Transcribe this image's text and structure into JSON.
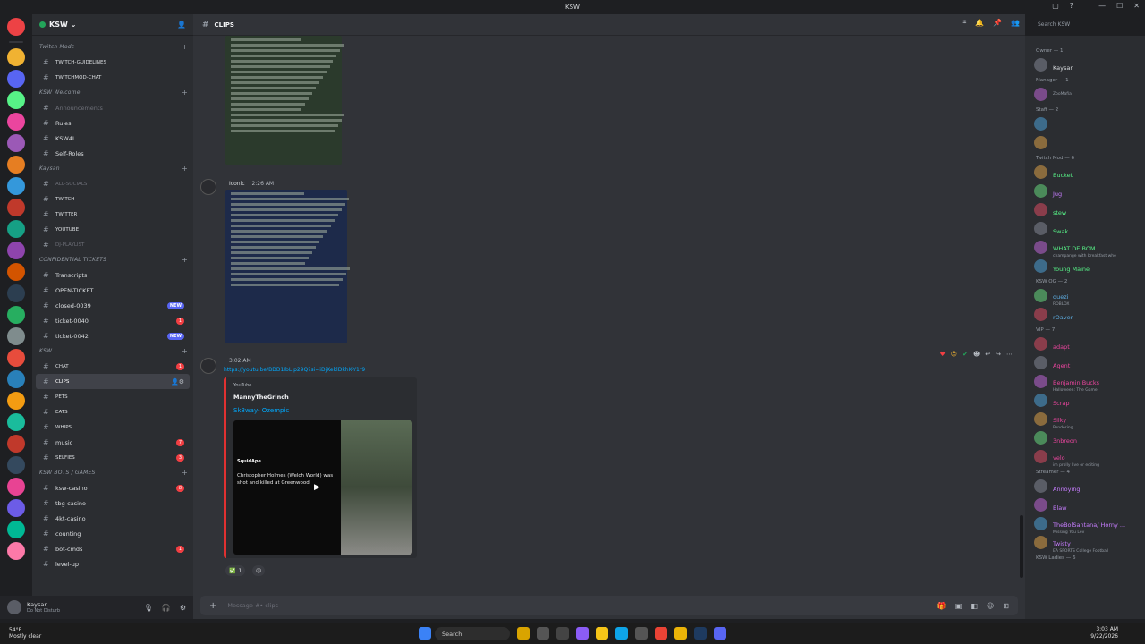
{
  "window": {
    "title": "KSW"
  },
  "server": {
    "name": "KSW"
  },
  "channels": [
    {
      "type": "cat",
      "label": "Twitch Mods"
    },
    {
      "type": "ch",
      "label": "TWITCH-GUIDELINES",
      "small": true
    },
    {
      "type": "ch",
      "label": "TWITCHMOD-CHAT",
      "small": true
    },
    {
      "type": "cat",
      "label": "KSW Welcome"
    },
    {
      "type": "ch",
      "label": "Announcements",
      "muted": true
    },
    {
      "type": "ch",
      "label": "Rules"
    },
    {
      "type": "ch",
      "label": "KSW4L"
    },
    {
      "type": "ch",
      "label": "Self-Roles"
    },
    {
      "type": "cat",
      "label": "Kaysan"
    },
    {
      "type": "ch",
      "label": "ALL-SOCIALS",
      "small": true,
      "muted": true
    },
    {
      "type": "ch",
      "label": "TWITCH",
      "small": true
    },
    {
      "type": "ch",
      "label": "TWITTER",
      "small": true
    },
    {
      "type": "ch",
      "label": "YOUTUBE",
      "small": true
    },
    {
      "type": "ch",
      "label": "DJ-PLAYLIST",
      "small": true,
      "muted": true
    },
    {
      "type": "cat",
      "label": "CONFIDENTIAL TICKETS"
    },
    {
      "type": "ch",
      "label": "Transcripts"
    },
    {
      "type": "ch",
      "label": "OPEN-TICKET"
    },
    {
      "type": "ch",
      "label": "closed-0039",
      "newb": "NEW"
    },
    {
      "type": "ch",
      "label": "ticket-0040",
      "badge": "1"
    },
    {
      "type": "ch",
      "label": "ticket-0042",
      "newb": "NEW"
    },
    {
      "type": "cat",
      "label": "KSW"
    },
    {
      "type": "ch",
      "label": "CHAT",
      "small": true,
      "badge": "1"
    },
    {
      "type": "ch",
      "label": "CLIPS",
      "small": true,
      "sel": true
    },
    {
      "type": "ch",
      "label": "PETS",
      "small": true
    },
    {
      "type": "ch",
      "label": "EATS",
      "small": true
    },
    {
      "type": "ch",
      "label": "WHIPS",
      "small": true
    },
    {
      "type": "ch",
      "label": "music",
      "badge": "7"
    },
    {
      "type": "ch",
      "label": "SELFIES",
      "small": true,
      "badge": "3"
    },
    {
      "type": "cat",
      "label": "KSW BOTS / GAMES"
    },
    {
      "type": "ch",
      "label": "ksw-casino",
      "badge": "8"
    },
    {
      "type": "ch",
      "label": "tbg-casino"
    },
    {
      "type": "ch",
      "label": "4kt-casino"
    },
    {
      "type": "ch",
      "label": "counting"
    },
    {
      "type": "ch",
      "label": "bot-cmds",
      "badge": "1"
    },
    {
      "type": "ch",
      "label": "level-up"
    }
  ],
  "user": {
    "name": "Kaysan",
    "status": "Do Not Disturb"
  },
  "header": {
    "channel": "CLIPS",
    "search_placeholder": "Search KSW"
  },
  "message2": {
    "author": "Iconic",
    "time": "2:26 AM"
  },
  "message3": {
    "time": "3:02 AM",
    "link": "https://youtu.be/BDD1IbL p29Q?si=iDjKeklDkhK-Y1r9"
  },
  "embed": {
    "provider": "YouTube",
    "author": "MannyTheGrinch",
    "title": "Sk8way- Ozempic",
    "tweet_account": "SquidApe",
    "tweet_text": "Christopher Holmes (Welch World) was shot and killed at Greenwood"
  },
  "reactions": {
    "check_count": "1"
  },
  "composer": {
    "placeholder": "Message #• clips"
  },
  "member_roles": [
    {
      "label": "Owner — 1",
      "members": [
        {
          "name": "Kaysan",
          "color": "#dbdee1"
        }
      ]
    },
    {
      "label": "Manager — 1",
      "members": [
        {
          "name": "",
          "color": "#f23f43",
          "status": "ZooMafia"
        }
      ]
    },
    {
      "label": "Staff — 2",
      "members": [
        {
          "name": "",
          "color": "#5865f2"
        },
        {
          "name": "",
          "color": "#5865f2"
        }
      ]
    },
    {
      "label": "Twitch Mod — 6",
      "members": [
        {
          "name": "Bucket",
          "color": "#57f287"
        },
        {
          "name": "Jug",
          "color": "#c77dff"
        },
        {
          "name": "stew",
          "color": "#57f287"
        },
        {
          "name": "Swak",
          "color": "#57f287"
        },
        {
          "name": "WHAT DE BOM...",
          "color": "#57f287",
          "status": "champange with breakfast whe"
        },
        {
          "name": "Young Maine",
          "color": "#57f287"
        }
      ]
    },
    {
      "label": "KSW OG — 2",
      "members": [
        {
          "name": "quezi",
          "color": "#5dade2",
          "status": "ROBLOX"
        },
        {
          "name": "rOaver",
          "color": "#5dade2"
        }
      ]
    },
    {
      "label": "VIP — 7",
      "members": [
        {
          "name": "adapt",
          "color": "#eb459e"
        },
        {
          "name": "Agent",
          "color": "#eb459e"
        },
        {
          "name": "Benjamin Bucks",
          "color": "#eb459e",
          "status": "Halloween: The Game"
        },
        {
          "name": "Scrap",
          "color": "#eb459e"
        },
        {
          "name": "Silky",
          "color": "#eb459e",
          "status": "Pondering"
        },
        {
          "name": "3nbreon",
          "color": "#eb459e"
        },
        {
          "name": "velo",
          "color": "#eb459e",
          "status": "im prolly live or editing"
        }
      ]
    },
    {
      "label": "Streamer — 4",
      "members": [
        {
          "name": "Annoying",
          "color": "#c77dff"
        },
        {
          "name": "Blaw",
          "color": "#c77dff"
        },
        {
          "name": "TheBolSantana/ Horny ...",
          "color": "#c77dff",
          "status": "Missing You Lev"
        },
        {
          "name": "Twisty",
          "color": "#c77dff",
          "status": "EA SPORTS College Football"
        }
      ]
    },
    {
      "label": "KSW Ladies — 6",
      "members": []
    }
  ],
  "taskbar": {
    "weather_temp": "54°F",
    "weather_desc": "Mostly clear",
    "search": "Search",
    "time": "3:03 AM",
    "date": "9/22/2026"
  }
}
